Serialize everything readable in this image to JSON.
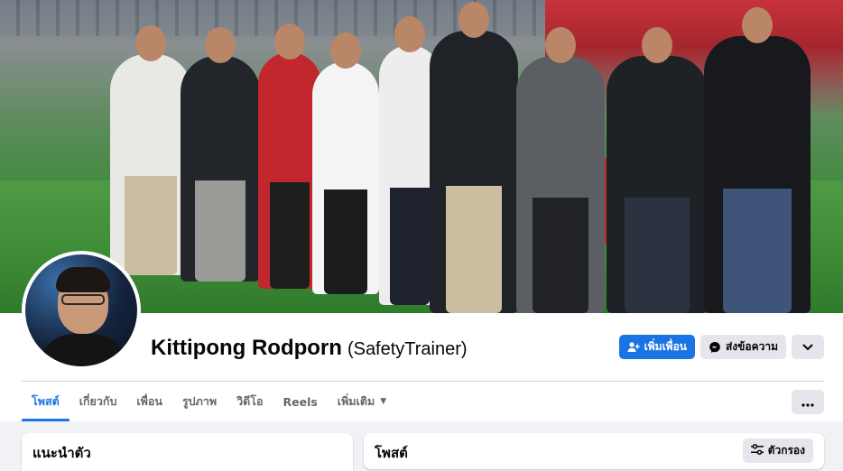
{
  "profile": {
    "name": "Kittipong Rodporn",
    "alternate_name": "(SafetyTrainer)"
  },
  "actions": {
    "add_friend_label": "เพิ่มเพื่อน",
    "message_label": "ส่งข้อความ"
  },
  "tabs": [
    {
      "label": "โพสต์"
    },
    {
      "label": "เกี่ยวกับ"
    },
    {
      "label": "เพื่อน"
    },
    {
      "label": "รูปภาพ"
    },
    {
      "label": "วิดีโอ"
    },
    {
      "label": "Reels"
    },
    {
      "label": "เพิ่มเติม"
    }
  ],
  "intro_card": {
    "title": "แนะนำตัว"
  },
  "posts_card": {
    "title": "โพสต์",
    "filter_label": "ตัวกรอง"
  },
  "colors": {
    "accent": "#1b74e4",
    "button_secondary": "#e4e6eb",
    "page_background": "#f0f2f5"
  },
  "icons": {
    "add_friend": "person-plus-icon",
    "message": "messenger-icon",
    "dropdown": "chevron-down-icon",
    "more": "ellipsis-icon",
    "filter": "sliders-icon"
  }
}
